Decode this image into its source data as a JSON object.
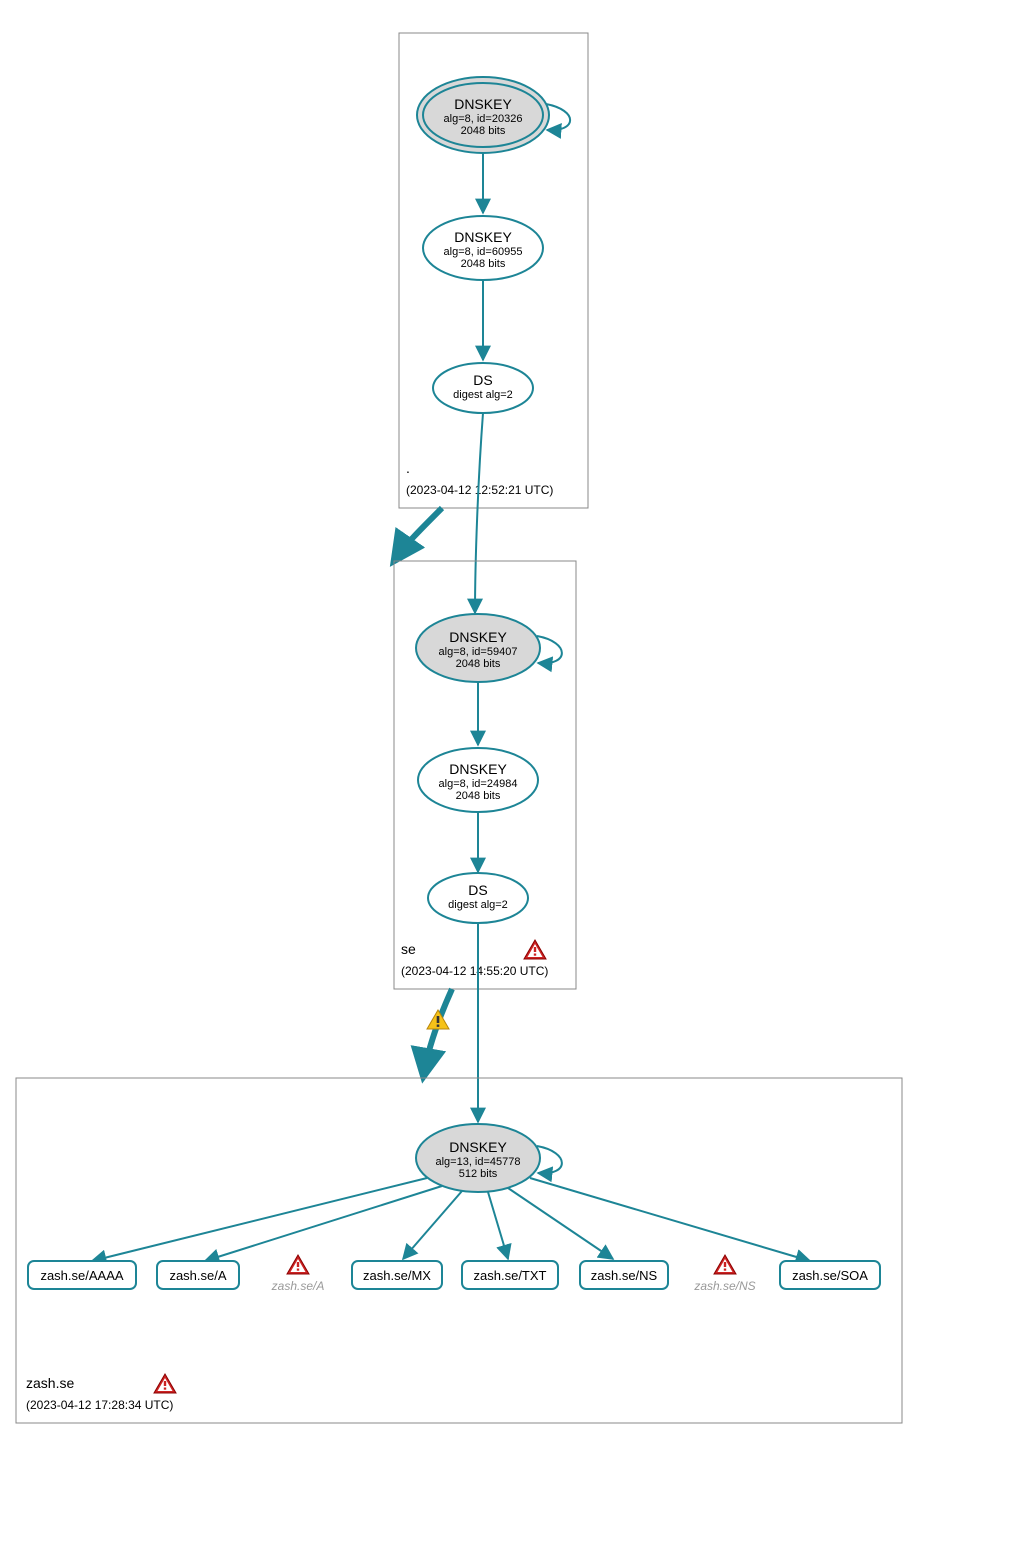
{
  "colors": {
    "teal": "#1d8596",
    "grayFill": "#d8d8d8",
    "border": "#999999",
    "box": "#888888"
  },
  "zones": {
    "root": {
      "label": ".",
      "timestamp": "(2023-04-12 12:52:21 UTC)",
      "warning": false
    },
    "se": {
      "label": "se",
      "timestamp": "(2023-04-12 14:55:20 UTC)",
      "warning": true
    },
    "zash": {
      "label": "zash.se",
      "timestamp": "(2023-04-12 17:28:34 UTC)",
      "warning": true
    }
  },
  "nodes": {
    "root_ksk": {
      "title": "DNSKEY",
      "line2": "alg=8, id=20326",
      "line3": "2048 bits"
    },
    "root_zsk": {
      "title": "DNSKEY",
      "line2": "alg=8, id=60955",
      "line3": "2048 bits"
    },
    "root_ds": {
      "title": "DS",
      "line2": "digest alg=2"
    },
    "se_ksk": {
      "title": "DNSKEY",
      "line2": "alg=8, id=59407",
      "line3": "2048 bits"
    },
    "se_zsk": {
      "title": "DNSKEY",
      "line2": "alg=8, id=24984",
      "line3": "2048 bits"
    },
    "se_ds": {
      "title": "DS",
      "line2": "digest alg=2"
    },
    "zash_ksk": {
      "title": "DNSKEY",
      "line2": "alg=13, id=45778",
      "line3": "512 bits"
    }
  },
  "rrsets": {
    "aaaa": "zash.se/AAAA",
    "a": "zash.se/A",
    "mx": "zash.se/MX",
    "txt": "zash.se/TXT",
    "ns": "zash.se/NS",
    "soa": "zash.se/SOA"
  },
  "missing": {
    "a": "zash.se/A",
    "ns": "zash.se/NS"
  },
  "delegation_warning": true
}
